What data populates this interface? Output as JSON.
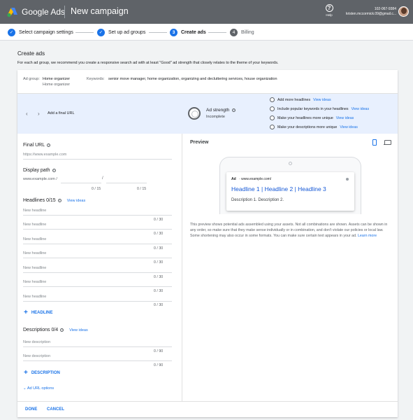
{
  "header": {
    "brand": "Google Ads",
    "campaign_title": "New campaign",
    "help_label": "Help",
    "account_id": "102-067-9384",
    "account_email": "kristen.mccormick.09@gmail.c..."
  },
  "steps": [
    {
      "label": "Select campaign settings",
      "state": "done",
      "icon": "check-icon"
    },
    {
      "label": "Set up ad groups",
      "state": "done",
      "icon": "check-icon"
    },
    {
      "label": "Create ads",
      "state": "active",
      "number": "3"
    },
    {
      "label": "Billing",
      "state": "pending",
      "number": "4"
    }
  ],
  "page": {
    "title": "Create ads",
    "intro": "For each ad group, we recommend you create a responsive search ad with at least \"Good\" ad strength that closely relates to the theme of your keywords."
  },
  "ad_group": {
    "label": "Ad group:",
    "value_line1": "Home organizer",
    "value_line2": "Home organizer",
    "keywords_label": "Keywords:",
    "keywords": "senior move manager, home organization, organizing and decluttering services, house organization"
  },
  "strength": {
    "add_final_url": "Add a final URL",
    "title": "Ad strength",
    "status": "Incomplete",
    "suggestions": [
      {
        "text": "Add more headlines",
        "link": "View ideas"
      },
      {
        "text": "Include popular keywords in your headlines",
        "link": "View ideas"
      },
      {
        "text": "Make your headlines more unique",
        "link": "View ideas"
      },
      {
        "text": "Make your descriptions more unique",
        "link": "View ideas"
      }
    ]
  },
  "form": {
    "final_url_label": "Final URL",
    "final_url_placeholder": "https://www.example.com",
    "display_path_label": "Display path",
    "display_domain": "www.example.com /",
    "path_sep": "/",
    "path1_count": "0 / 15",
    "path2_count": "0 / 15",
    "headlines_label": "Headlines 0/15",
    "headlines_link": "View ideas",
    "headline_placeholder": "New headline",
    "headline_count": "0 / 30",
    "add_headline": "HEADLINE",
    "descriptions_label": "Descriptions 0/4",
    "descriptions_link": "View ideas",
    "description_placeholder": "New description",
    "description_count": "0 / 90",
    "add_description": "DESCRIPTION",
    "url_options": "Ad URL options"
  },
  "preview": {
    "title": "Preview",
    "ad_label": "Ad",
    "ad_url": "www.example.com/",
    "headline": "Headline 1 | Headline 2 | Headline 3",
    "description": "Description 1. Description 2.",
    "note": "This preview shows potential ads assembled using your assets. Not all combinations are shown. Assets can be shown in any order, so make sure that they make sense individually or in combination, and don't violate our policies or local law. Some shortening may also occur in some formats. You can make sure certain text appears in your ad.",
    "learn_more": "Learn more"
  },
  "footer": {
    "done": "DONE",
    "cancel": "CANCEL"
  },
  "colors": {
    "accent": "#1a73e8",
    "topbar": "#5f6368",
    "strength_bg": "#e8f0fe"
  }
}
